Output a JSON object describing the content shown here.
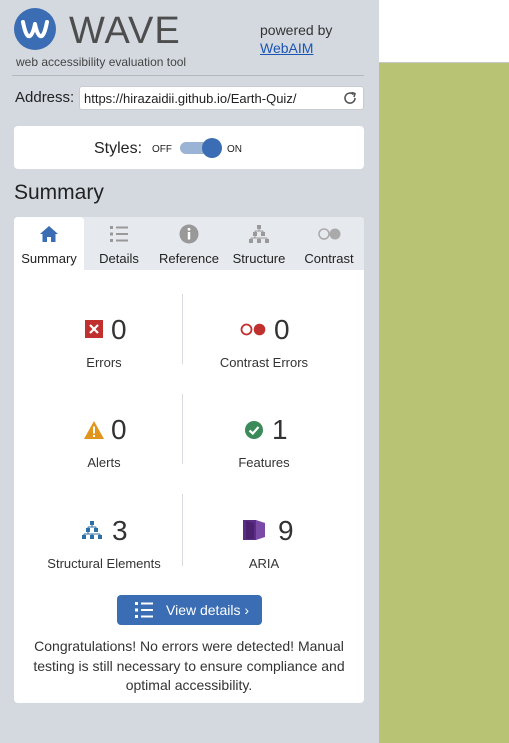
{
  "header": {
    "logo_text": "WAVE",
    "tagline": "web accessibility evaluation tool",
    "powered_by": "powered by",
    "webaim_link": "WebAIM"
  },
  "address": {
    "label": "Address:",
    "value": "https://hirazaidii.github.io/Earth-Quiz/"
  },
  "styles": {
    "label": "Styles:",
    "off": "OFF",
    "on": "ON",
    "enabled": true
  },
  "summary_title": "Summary",
  "tabs": [
    {
      "label": "Summary",
      "icon": "home-icon",
      "active": true
    },
    {
      "label": "Details",
      "icon": "list-icon",
      "active": false
    },
    {
      "label": "Reference",
      "icon": "info-icon",
      "active": false
    },
    {
      "label": "Structure",
      "icon": "hierarchy-icon",
      "active": false
    },
    {
      "label": "Contrast",
      "icon": "contrast-icon",
      "active": false
    }
  ],
  "stats": {
    "errors": {
      "count": "0",
      "label": "Errors",
      "icon": "error-icon"
    },
    "contrast_errors": {
      "count": "0",
      "label": "Contrast Errors",
      "icon": "contrast-error-icon"
    },
    "alerts": {
      "count": "0",
      "label": "Alerts",
      "icon": "alert-icon"
    },
    "features": {
      "count": "1",
      "label": "Features",
      "icon": "feature-check-icon"
    },
    "structural": {
      "count": "3",
      "label": "Structural Elements",
      "icon": "structure-icon"
    },
    "aria": {
      "count": "9",
      "label": "ARIA",
      "icon": "aria-icon"
    }
  },
  "view_details": "View details ›",
  "congrats": "Congratulations! No errors were detected! Manual testing is still necessary to ensure compliance and optimal accessibility.",
  "colors": {
    "accent": "#3a6db3",
    "error": "#c0302f",
    "alert": "#e0961d",
    "feature": "#3a8a5a",
    "structure": "#2c6ea6",
    "aria": "#5b2d84",
    "page_bg": "#b8c373"
  }
}
